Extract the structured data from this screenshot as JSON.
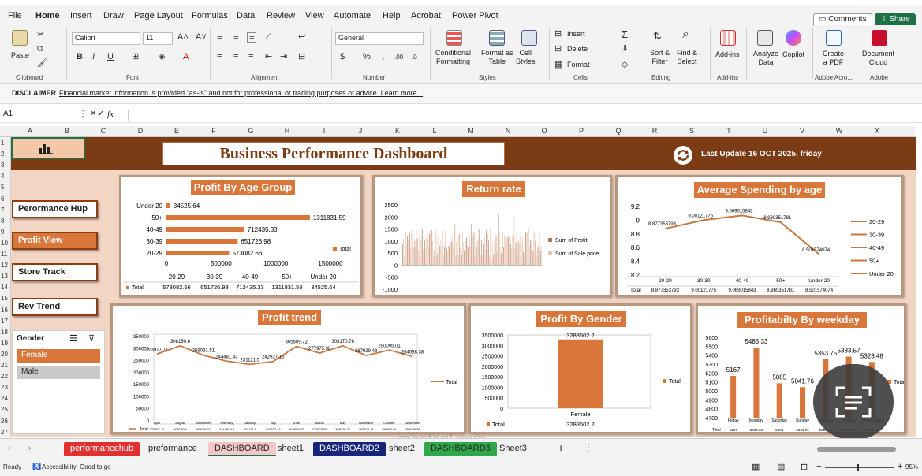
{
  "menu": {
    "items": [
      "File",
      "Home",
      "Insert",
      "Draw",
      "Page Layout",
      "Formulas",
      "Data",
      "Review",
      "View",
      "Automate",
      "Help",
      "Acrobat",
      "Power Pivot"
    ],
    "active": "Home",
    "comments": "Comments",
    "share": "Share"
  },
  "ribbon": {
    "paste": "Paste",
    "clipboard": "Clipboard",
    "font_name": "Calibri",
    "font_size": "11",
    "font_group": "Font",
    "alignment_group": "Alignment",
    "number_format": "General",
    "number_group": "Number",
    "conditional": "Conditional\nFormatting",
    "format_table": "Format as\nTable",
    "cell_styles": "Cell\nStyles",
    "styles_group": "Styles",
    "insert": "Insert",
    "delete": "Delete",
    "format": "Format",
    "cells_group": "Cells",
    "sort_filter": "Sort &\nFilter",
    "find_select": "Find &\nSelect",
    "editing_group": "Editing",
    "addins": "Add-ins",
    "addins_group": "Add-ins",
    "analyze": "Analyze\nData",
    "copilot": "Copilot",
    "create_pdf": "Create\na PDF",
    "document_cloud": "Document\nCloud",
    "acrobat_group": "Adobe Acro...",
    "adobe_group": "Adobe"
  },
  "disclaimer": {
    "label": "DISCLAIMER",
    "text": "Financial market information is provided \"as-is\" and not for professional or trading purposes or advice. Learn more..."
  },
  "formula": {
    "cell": "A1",
    "fx": "fx"
  },
  "columns": [
    "A",
    "B",
    "C",
    "D",
    "E",
    "F",
    "G",
    "H",
    "I",
    "J",
    "K",
    "L",
    "M",
    "N",
    "O",
    "P",
    "Q",
    "R",
    "S",
    "T",
    "U",
    "V",
    "W",
    "X"
  ],
  "rows": [
    "1",
    "2",
    "3",
    "4",
    "5",
    "6",
    "7",
    "8",
    "9",
    "10",
    "11",
    "12",
    "13",
    "14",
    "15",
    "16",
    "17",
    "18",
    "19",
    "20",
    "21",
    "22",
    "23",
    "24",
    "25",
    "26",
    "27"
  ],
  "dashboard": {
    "title": "Business Performance Dashboard",
    "update": "Last Update 16 OCT 2025, friday"
  },
  "nav": [
    "Perormance Hup",
    "Profit View",
    "Store Track",
    "Rev Trend"
  ],
  "slicer": {
    "title": "Gender",
    "items": [
      "Female",
      "Male"
    ]
  },
  "tabs": [
    {
      "label": "performancehub",
      "color": "#e03030",
      "fg": "#ffffff"
    },
    {
      "label": "preformance",
      "color": "",
      "fg": "#222222"
    },
    {
      "label": "DASHBOARD",
      "color": "#f3c7c7",
      "fg": "#222222"
    },
    {
      "label": "sheet1",
      "color": "",
      "fg": "#222222"
    },
    {
      "label": "DASHBOARD2",
      "color": "#17267a",
      "fg": "#ffffff"
    },
    {
      "label": "sheet2",
      "color": "",
      "fg": "#222222"
    },
    {
      "label": "DASHBOARD3",
      "color": "#2ea84a",
      "fg": "#222222"
    },
    {
      "label": "Sheet3",
      "color": "",
      "fg": "#222222"
    }
  ],
  "status": {
    "ready": "Ready",
    "accessibility": "Accessibility: Good to go",
    "zoom": "95%"
  },
  "watermark": "mostaql.com",
  "colors": {
    "accent": "#d9763a",
    "banner": "#7b3b14",
    "bar": "#d9763a",
    "line": "#c8773f",
    "excel_green": "#1e7145"
  },
  "chart_data": [
    {
      "id": "age",
      "type": "bar",
      "orientation": "horizontal",
      "title": "Profit By Age Group",
      "categories": [
        "Under 20",
        "50+",
        "40-49",
        "30-39",
        "20-29"
      ],
      "series": [
        {
          "name": "Total",
          "values": [
            34525.64,
            1311831.59,
            712435.33,
            651726.98,
            573082.66
          ]
        }
      ],
      "data_labels": [
        "34525.64",
        "1311831.59",
        "712435.33",
        "651726.98",
        "573082.66"
      ],
      "xticks": [
        "0",
        "500000",
        "1000000",
        "1500000"
      ],
      "xlim": [
        0,
        1500000
      ],
      "table": {
        "header": [
          "20-29",
          "30-39",
          "40-49",
          "50+",
          "Under 20"
        ],
        "row_label": "Total",
        "values": [
          "573082.66",
          "651726.98",
          "712435.33",
          "1311831.59",
          "34525.64"
        ]
      }
    },
    {
      "id": "ret",
      "type": "bar",
      "title": "Return rate",
      "yticks": [
        "2500",
        "2000",
        "1500",
        "1000",
        "500",
        "0",
        "-500",
        "-1000"
      ],
      "ylim": [
        -1000,
        2500
      ],
      "legend": [
        "Sum of Profit",
        "Sum of Sale price"
      ],
      "values": [
        900,
        1100,
        450,
        900,
        1350,
        850,
        1200,
        1050,
        1400,
        1300,
        700,
        1450,
        700,
        1300,
        750,
        1000,
        650,
        1450,
        1100,
        600,
        1250,
        300,
        1050,
        1200,
        1500,
        650,
        1300,
        1050,
        650,
        1250,
        1000,
        1100,
        800,
        1300,
        1450,
        1250,
        1450,
        1000,
        350,
        600,
        1300,
        1550,
        450,
        1150,
        650,
        800,
        1050,
        750,
        1050,
        1450,
        400,
        750,
        1400,
        950,
        700,
        600,
        800,
        800,
        1300,
        950,
        1000,
        1200,
        800,
        1650,
        1700,
        400,
        950,
        1250,
        450,
        1300,
        700,
        1500,
        450,
        1350,
        950,
        600,
        1100,
        1000,
        1150,
        750,
        700,
        750,
        1200,
        800,
        1700,
        1150,
        1200,
        1350,
        450,
        1300,
        750,
        1000,
        1000,
        1500,
        1250,
        400,
        1050,
        400,
        800,
        850,
        1200,
        650,
        1450,
        1350,
        1300,
        1050,
        400,
        1500,
        1100,
        300,
        1000,
        450,
        1100,
        800,
        1200,
        550,
        1200,
        2100,
        1350,
        750,
        500,
        1050,
        1400,
        750,
        1250,
        1150,
        1550,
        1150,
        1200,
        1150,
        1250,
        1350,
        900,
        700,
        1250,
        1250,
        2000,
        700,
        950,
        1400,
        350,
        1000,
        850,
        1250,
        300,
        950,
        1150,
        550,
        1050,
        400,
        1350,
        1300,
        1400,
        450,
        1550,
        800,
        1050,
        950,
        650,
        600,
        1300,
        1350,
        1000,
        350,
        650,
        750,
        850,
        1350,
        600,
        800
      ]
    },
    {
      "id": "avg",
      "type": "line",
      "title": "Average Spending by age",
      "categories": [
        "20-29",
        "30-39",
        "40-49",
        "50+",
        "Under 20"
      ],
      "series": [
        {
          "name": "Total",
          "values": [
            8.877353793,
            9.00121775,
            9.069015843,
            8.969351781,
            8.501574074
          ]
        }
      ],
      "data_labels": [
        "8.877353793",
        "9.00121775",
        "9.069015843",
        "8.969351781",
        "8.501574074"
      ],
      "yticks": [
        "9.2",
        "9",
        "8.8",
        "8.6",
        "8.4",
        "8.2"
      ],
      "ylim": [
        8.2,
        9.2
      ],
      "legend": [
        "20-29",
        "30-39",
        "40-49",
        "50+",
        "Under 20"
      ],
      "table": {
        "header": [
          "20-29",
          "30-39",
          "40-49",
          "50+",
          "Under 20"
        ],
        "row_label": "Total",
        "values": [
          "8.877353793",
          "9.00121775",
          "9.069015843",
          "8.969351781",
          "8.501574074"
        ]
      }
    },
    {
      "id": "trend",
      "type": "line",
      "title": "Profit trend",
      "categories": [
        "April",
        "August",
        "December",
        "February",
        "January",
        "July",
        "June",
        "March",
        "May",
        "November",
        "October",
        "September"
      ],
      "series": [
        {
          "name": "Total",
          "values": [
            273917.71,
            308150.6,
            269091.51,
            244481.43,
            231121.5,
            242927.16,
            305609.72,
            277975.38,
            308170.76,
            267929.48,
            290095.01,
            264098.38
          ]
        }
      ],
      "data_labels": [
        "273917.71",
        "308150.6",
        "269091.51",
        "244481.43",
        "231121.5",
        "242927.16",
        "305609.72",
        "277975.38",
        "308170.76",
        "267929.48",
        "290095.01",
        "264098.38"
      ],
      "yticks": [
        "350000",
        "300000",
        "250000",
        "200000",
        "150000",
        "100000",
        "50000",
        "0"
      ],
      "ylim": [
        0,
        350000
      ],
      "legend": [
        "Total"
      ],
      "row_label": "Total"
    },
    {
      "id": "gender",
      "type": "bar",
      "title": "Profit By Gender",
      "categories": [
        "Female"
      ],
      "series": [
        {
          "name": "Total",
          "values": [
            3283602.2
          ]
        }
      ],
      "data_labels": [
        "3283602.2"
      ],
      "yticks": [
        "3500000",
        "3000000",
        "2500000",
        "2000000",
        "1500000",
        "1000000",
        "500000",
        "0"
      ],
      "ylim": [
        0,
        3500000
      ],
      "legend": [
        "Total"
      ],
      "table": {
        "row_label": "Total",
        "values": [
          "3283602.2"
        ]
      }
    },
    {
      "id": "week",
      "type": "bar",
      "title": "Profitabilty By weekday",
      "categories": [
        "Friday",
        "Monday",
        "Saturday",
        "Sunday",
        "Thursday",
        "Tuesday",
        "Wednesday"
      ],
      "series": [
        {
          "name": "Total",
          "values": [
            5167,
            5485.33,
            5085,
            5041.76,
            5353.75,
            5383.57,
            5323.48
          ]
        }
      ],
      "data_labels": [
        "5167",
        "5485.33",
        "5085",
        "5041.76",
        "5353.75",
        "5383.57",
        "5323.48"
      ],
      "yticks": [
        "5600",
        "5500",
        "5400",
        "5300",
        "5200",
        "5100",
        "5000",
        "4900",
        "4800",
        "4700"
      ],
      "ylim": [
        4700,
        5600
      ],
      "legend": [
        "Total"
      ],
      "table": {
        "row_label": "Total",
        "values": [
          "5167",
          "5485.33",
          "5085",
          "5041.76",
          "5353.75",
          "5383.57",
          "5323.48"
        ]
      }
    }
  ]
}
